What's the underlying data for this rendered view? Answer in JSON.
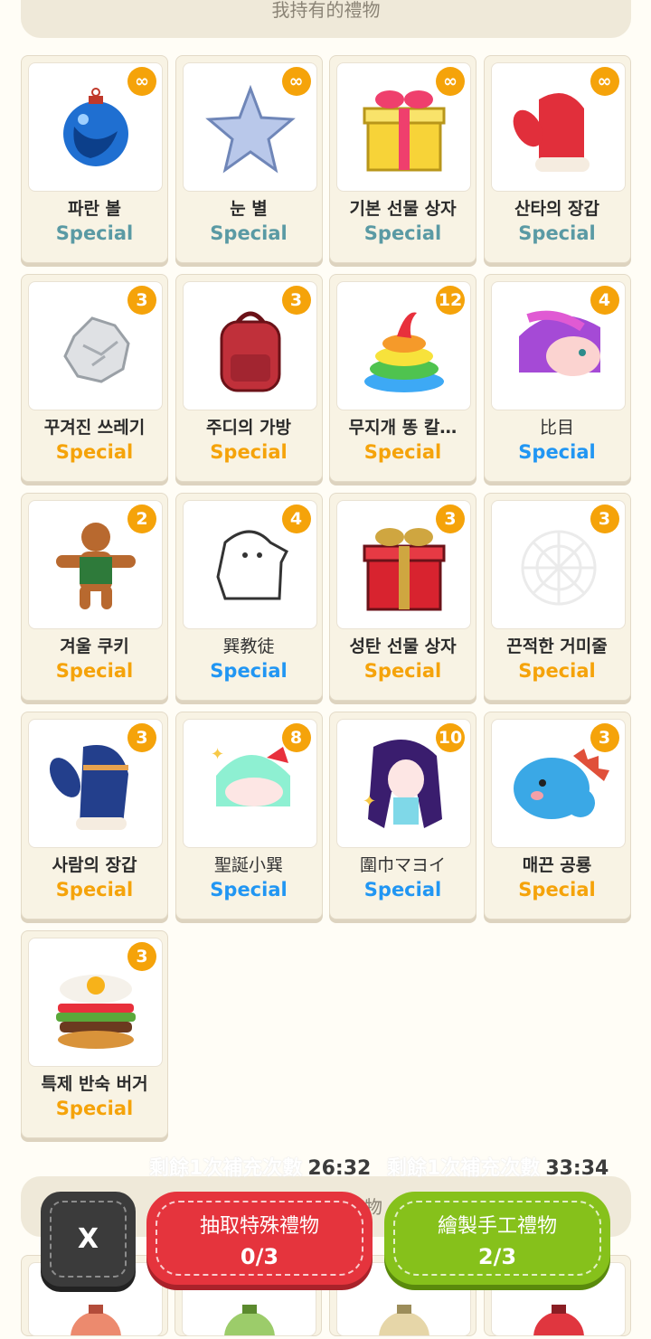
{
  "header": {
    "title": "我持有的禮物"
  },
  "items": [
    {
      "name": "파란 볼",
      "tag": "Special",
      "badge": "∞",
      "icon": "blue-ornament-icon",
      "tagColor": "#5a9aa4",
      "bold": true
    },
    {
      "name": "눈 별",
      "tag": "Special",
      "badge": "∞",
      "icon": "star-icon",
      "tagColor": "#5a9aa4",
      "bold": true
    },
    {
      "name": "기본 선물 상자",
      "tag": "Special",
      "badge": "∞",
      "icon": "gift-box-icon",
      "tagColor": "#5a9aa4",
      "bold": true
    },
    {
      "name": "산타의 장갑",
      "tag": "Special",
      "badge": "∞",
      "icon": "red-mitten-icon",
      "tagColor": "#5a9aa4",
      "bold": true
    },
    {
      "name": "꾸겨진 쓰레기",
      "tag": "Special",
      "badge": "3",
      "icon": "crumpled-paper-icon",
      "tagColor": "#f5a30a",
      "bold": true
    },
    {
      "name": "주디의 가방",
      "tag": "Special",
      "badge": "3",
      "icon": "backpack-icon",
      "tagColor": "#f5a30a",
      "bold": true
    },
    {
      "name": "무지개 똥 칼…",
      "tag": "Special",
      "badge": "12",
      "icon": "rainbow-poop-icon",
      "tagColor": "#f5a30a",
      "bold": true
    },
    {
      "name": "比目",
      "tag": "Special",
      "badge": "4",
      "icon": "pink-hair-girl-icon",
      "tagColor": "#2196f3",
      "bold": false
    },
    {
      "name": "겨울 쿠키",
      "tag": "Special",
      "badge": "2",
      "icon": "gingerbread-icon",
      "tagColor": "#f5a30a",
      "bold": true
    },
    {
      "name": "巽教徒",
      "tag": "Special",
      "badge": "4",
      "icon": "ghost-cat-icon",
      "tagColor": "#2196f3",
      "bold": false
    },
    {
      "name": "성탄 선물 상자",
      "tag": "Special",
      "badge": "3",
      "icon": "christmas-gift-icon",
      "tagColor": "#f5a30a",
      "bold": true
    },
    {
      "name": "끈적한 거미줄",
      "tag": "Special",
      "badge": "3",
      "icon": "spider-web-icon",
      "tagColor": "#f5a30a",
      "bold": true
    },
    {
      "name": "사람의 장갑",
      "tag": "Special",
      "badge": "3",
      "icon": "blue-mitten-icon",
      "tagColor": "#f5a30a",
      "bold": true
    },
    {
      "name": "聖誕小巽",
      "tag": "Special",
      "badge": "8",
      "icon": "mint-hair-girl-icon",
      "tagColor": "#2196f3",
      "bold": false
    },
    {
      "name": "圍巾マヨイ",
      "tag": "Special",
      "badge": "10",
      "icon": "purple-hair-girl-icon",
      "tagColor": "#2196f3",
      "bold": false
    },
    {
      "name": "매끈 공룡",
      "tag": "Special",
      "badge": "3",
      "icon": "blue-dinosaur-icon",
      "tagColor": "#f5a30a",
      "bold": true
    },
    {
      "name": "특제 반숙 버거",
      "tag": "Special",
      "badge": "3",
      "icon": "burger-icon",
      "tagColor": "#f5a30a",
      "bold": true
    }
  ],
  "timers": [
    {
      "label": "剩餘1次補充次數",
      "value": "26:32"
    },
    {
      "label": "剩餘1次補充次數",
      "value": "33:34"
    }
  ],
  "bottom_section": {
    "title": "禮物"
  },
  "buttons": {
    "close": "X",
    "draw": {
      "label": "抽取特殊禮物",
      "count": "0/3"
    },
    "craft": {
      "label": "繪製手工禮物",
      "count": "2/3"
    }
  },
  "colors": {
    "accent_orange": "#f5a30a",
    "teal": "#5a9aa4",
    "blue": "#2196f3",
    "red": "#e5343d",
    "green": "#86c11b"
  }
}
